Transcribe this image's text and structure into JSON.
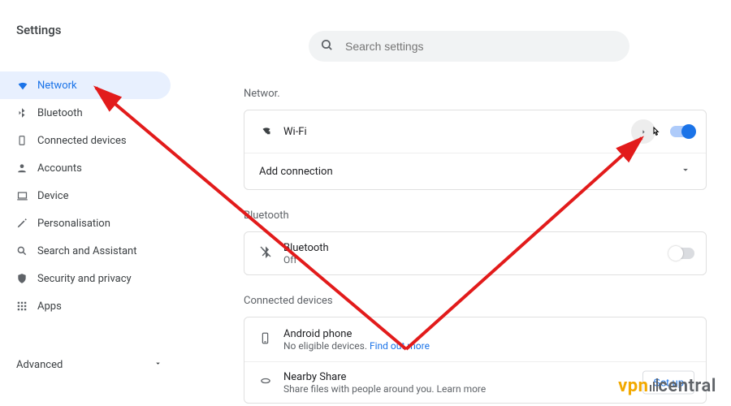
{
  "page_title": "Settings",
  "search": {
    "placeholder": "Search settings"
  },
  "sidebar": {
    "items": [
      {
        "label": "Network"
      },
      {
        "label": "Bluetooth"
      },
      {
        "label": "Connected devices"
      },
      {
        "label": "Accounts"
      },
      {
        "label": "Device"
      },
      {
        "label": "Personalisation"
      },
      {
        "label": "Search and Assistant"
      },
      {
        "label": "Security and privacy"
      },
      {
        "label": "Apps"
      }
    ],
    "advanced_label": "Advanced"
  },
  "sections": {
    "network": {
      "header": "Networ.",
      "wifi_label": "Wi-Fi",
      "add_connection_label": "Add connection"
    },
    "bluetooth": {
      "header": "Bluetooth",
      "title": "Bluetooth",
      "status": "Off"
    },
    "connected": {
      "header": "Connected devices",
      "phone_title": "Android phone",
      "phone_sub_prefix": "No eligible devices. ",
      "phone_sub_link": "Find out more",
      "nearby_title": "Nearby Share",
      "nearby_sub": "Share files with people around you. Learn more",
      "setup_label": "Set up"
    }
  },
  "watermark": {
    "brand_left": "vpn",
    "brand_right": "central"
  }
}
